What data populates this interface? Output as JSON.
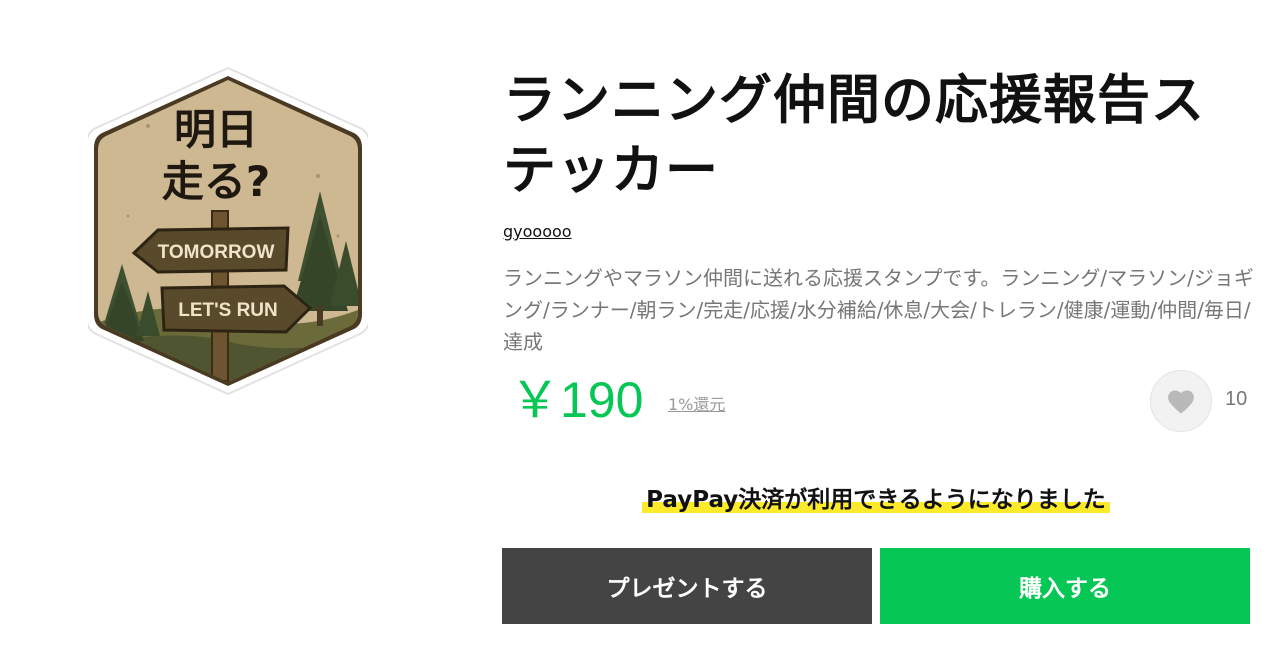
{
  "sticker": {
    "line1": "明日",
    "line2": "走る?",
    "sign_top": "TOMORROW",
    "sign_bottom": "LET'S RUN"
  },
  "product": {
    "title": "ランニング仲間の応援報告ステッカー",
    "author": "gyooooo",
    "description": "ランニングやマラソン仲間に送れる応援スタンプです。ランニング/マラソン/ジョギング/ランナー/朝ラン/完走/応援/水分補給/休息/大会/トレラン/健康/運動/仲間/毎日/達成",
    "price": "￥190",
    "cashback": "1%還元",
    "favorites": "10"
  },
  "notice": "PayPay決済が利用できるようになりました",
  "buttons": {
    "gift": "プレゼントする",
    "buy": "購入する"
  },
  "colors": {
    "accent": "#06c755",
    "gift_button": "#444444",
    "highlight": "#fcea2b",
    "sticker_border": "#4a3a22",
    "sticker_bg": "#cdb892"
  },
  "icons": [
    "heart-icon"
  ]
}
